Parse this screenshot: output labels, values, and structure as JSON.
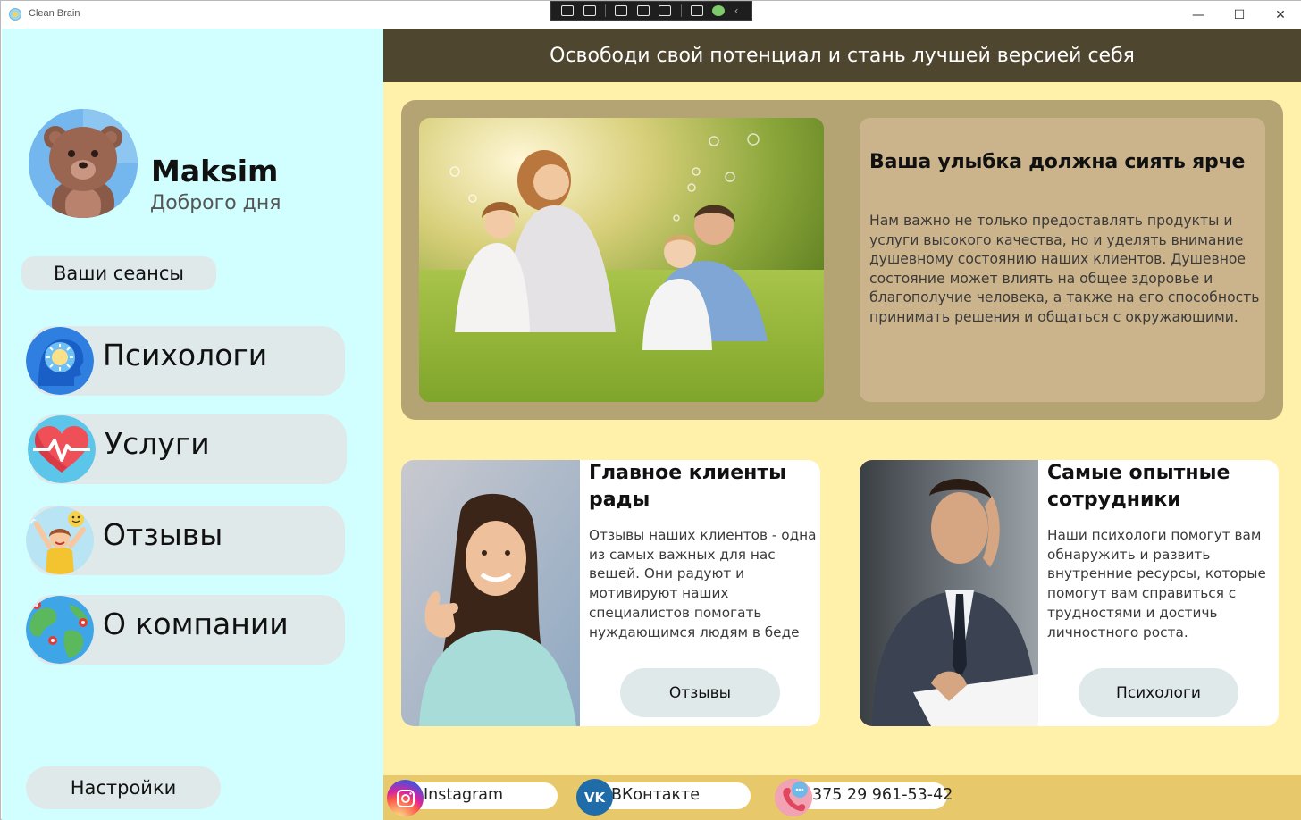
{
  "window": {
    "title": "Clean Brain",
    "minimize_glyph": "—",
    "maximize_glyph": "☐",
    "close_glyph": "✕"
  },
  "sidebar": {
    "user": {
      "name": "Maksim",
      "greeting": "Доброго дня",
      "avatar_icon": "bear-avatar"
    },
    "sessions_label": "Ваши сеансы",
    "nav": [
      {
        "label": "Психологи",
        "icon": "brain-head-icon"
      },
      {
        "label": "Услуги",
        "icon": "heart-pulse-icon"
      },
      {
        "label": "Отзывы",
        "icon": "happy-person-icon"
      },
      {
        "label": "О компании",
        "icon": "globe-icon"
      }
    ],
    "settings_label": "Настройки"
  },
  "main": {
    "banner": "Освободи свой потенциал и стань лучшей версией себя",
    "hero": {
      "title": "Ваша улыбка должна сиять ярче",
      "body": "Нам важно не только предоставлять продукты и услуги высокого качества, но и уделять внимание душевному состоянию наших клиентов. Душевное состояние может влиять на общее здоровье и благополучие человека, а также на его способность принимать решения и общаться с окружающими."
    },
    "cards": [
      {
        "title": "Главное клиенты рады",
        "body": "Отзывы наших клиентов - одна из самых важных для нас вещей. Они радуют и мотивируют наших специалистов помогать нуждающимся людям в беде",
        "button": "Отзывы"
      },
      {
        "title": "Самые опытные сотрудники",
        "body": "Наши психологи помогут вам обнаружить и развить внутренние ресурсы, которые помогут вам справиться с трудностями и достичь личностного роста.",
        "button": "Психологи"
      }
    ]
  },
  "footer": {
    "instagram": "Instagram",
    "vk": "ВКонтакте",
    "phone": "375 29 961-53-42"
  },
  "colors": {
    "sidebar_bg": "#d1fefe",
    "main_bg": "#fff1aa",
    "banner_bg": "#4f4630",
    "hero_frame": "#b4a474",
    "hero_text_bg": "#cbb48b",
    "footer_bg": "#e7c86b",
    "button_bg": "#dfe9ea"
  }
}
